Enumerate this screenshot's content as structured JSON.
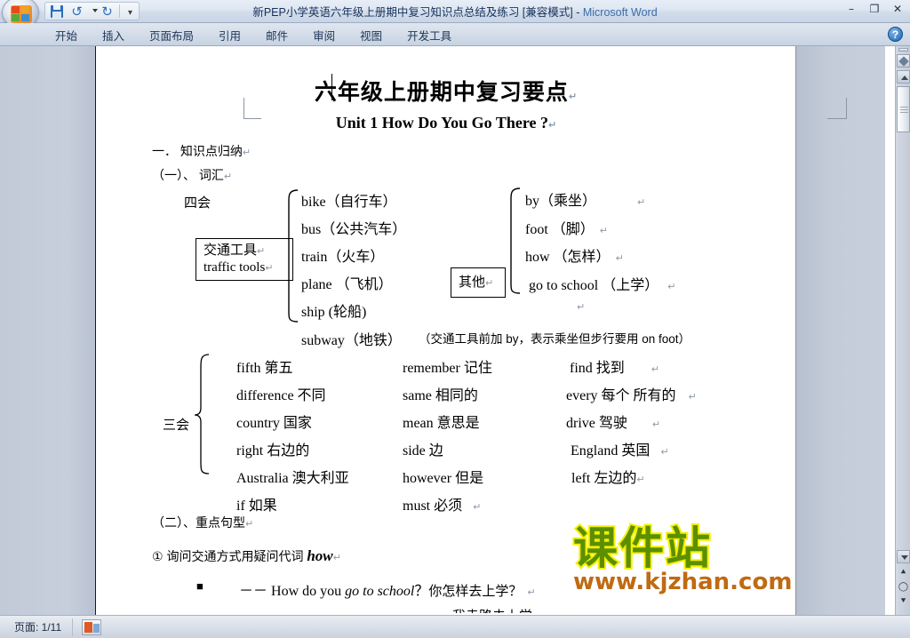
{
  "window": {
    "title": "新PEP小学英语六年级上册期中复习知识点总结及练习 [兼容模式]",
    "separator": " - ",
    "product": "Microsoft Word",
    "minimize": "–",
    "restore": "❐",
    "close": "✕"
  },
  "quick_access": {
    "save": "save-icon",
    "undo": "undo-icon",
    "undo_dropdown": "caret-down-icon",
    "redo": "redo-icon",
    "customize": "customize-qat-icon"
  },
  "ribbon": {
    "tabs": [
      {
        "label": "开始"
      },
      {
        "label": "插入"
      },
      {
        "label": "页面布局"
      },
      {
        "label": "引用"
      },
      {
        "label": "邮件"
      },
      {
        "label": "审阅"
      },
      {
        "label": "视图"
      },
      {
        "label": "开发工具"
      }
    ],
    "help": "?"
  },
  "document": {
    "title": "六年级上册期中复习要点",
    "title_mark": "↵",
    "subtitle": "Unit 1  How Do You Go There ?",
    "subtitle_mark": "↵",
    "section_one": "一．  知识点归纳",
    "section_one_mark": "↵",
    "section_vocab": "（一）、  词汇",
    "section_vocab_mark": "↵",
    "skill_four": "四会",
    "skill_three": "三会",
    "box_traffic_cn": "交通工具",
    "box_traffic_cn_mark": "↵",
    "box_traffic_en": "traffic tools",
    "box_traffic_en_mark": "↵",
    "box_other": "其他",
    "box_other_mark": "↵",
    "traffic_words": [
      {
        "text": "bike（自行车）",
        "mark": ""
      },
      {
        "text": "bus（公共汽车）",
        "mark": ""
      },
      {
        "text": "train（火车）",
        "mark": ""
      },
      {
        "text": "plane （飞机）",
        "mark": ""
      },
      {
        "text": "ship  (轮船)",
        "mark": ""
      },
      {
        "text": "subway（地铁）",
        "mark": ""
      }
    ],
    "other_words": [
      {
        "text": "by（乘坐）",
        "mark": "↵"
      },
      {
        "text": "foot （脚）",
        "mark": "↵"
      },
      {
        "text": "how （怎样）",
        "mark": "↵"
      },
      {
        "text": "go to school （上学）",
        "mark": "↵"
      }
    ],
    "orphan_mark": "↵",
    "traffic_note": "（交通工具前加 by，表示乘坐但步行要用 on foot）",
    "three_col1": [
      {
        "text": "fifth    第五",
        "mark": ""
      },
      {
        "text": "difference 不同",
        "mark": ""
      },
      {
        "text": "country 国家",
        "mark": ""
      },
      {
        "text": "right 右边的",
        "mark": ""
      },
      {
        "text": "Australia   澳大利亚",
        "mark": ""
      },
      {
        "text": "if   如果",
        "mark": ""
      }
    ],
    "three_col2": [
      {
        "text": "remember 记住",
        "mark": ""
      },
      {
        "text": "same 相同的",
        "mark": ""
      },
      {
        "text": "mean 意思是",
        "mark": ""
      },
      {
        "text": "side   边",
        "mark": ""
      },
      {
        "text": "however   但是",
        "mark": ""
      },
      {
        "text": "must 必须",
        "mark": "↵"
      }
    ],
    "three_col3": [
      {
        "text": "find 找到",
        "mark": "↵"
      },
      {
        "text": "every   每个 所有的",
        "mark": "↵"
      },
      {
        "text": "drive 驾驶",
        "mark": "↵"
      },
      {
        "text": "England   英国",
        "mark": "↵"
      },
      {
        "text": "left 左边的",
        "mark": "↵"
      }
    ],
    "section_sentence": "（二）、重点句型",
    "section_sentence_mark": "↵",
    "item1_prefix": "①  询问交通方式用疑问代词 ",
    "item1_em": "how",
    "item1_mark": "↵",
    "bullet": "■",
    "example1_dashes": "－－ ",
    "example1_a": "How do you ",
    "example1_em": "go to school",
    "example1_q": "？",
    "example1_cn": "你怎样去上学？",
    "example1_mark": "↵",
    "example2_cn_partial": "我走路去上学"
  },
  "watermark": {
    "cn": "课件站",
    "url": "www.kjzhan.com",
    "cn_color": "#5b8f00",
    "cn_stroke": "#f5f000",
    "url_color": "#c06a12"
  },
  "statusbar": {
    "page_label": "页面: 1/11",
    "view_icon": "page-thumbnail-icon"
  },
  "scrollbar": {
    "split_handle": "split-handle",
    "select_object_browse": "select-browse-object-icon",
    "scroll_up": "▲",
    "scroll_down": "▼",
    "previous_page": "⯅",
    "select_browse": "◯",
    "next_page": "⯆"
  }
}
